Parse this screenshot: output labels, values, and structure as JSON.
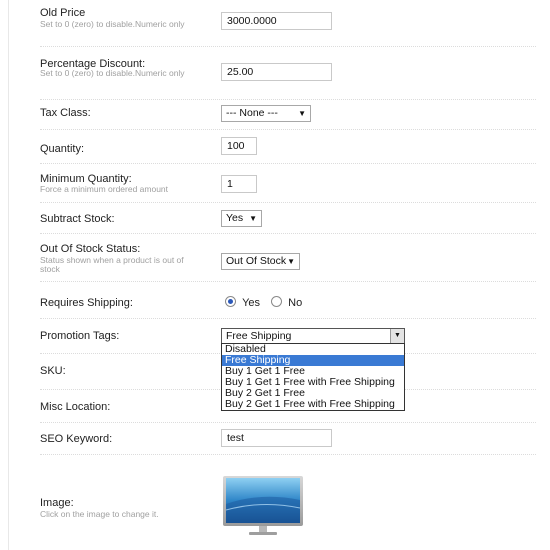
{
  "fields": {
    "old_price": {
      "label": "Old Price",
      "help": "Set to 0 (zero) to disable.Numeric only",
      "value": "3000.0000"
    },
    "percentage_discount": {
      "label": "Percentage Discount:",
      "help": "Set to 0 (zero) to disable.Numeric only",
      "value": "25.00"
    },
    "tax_class": {
      "label": "Tax Class:",
      "value": "--- None ---"
    },
    "quantity": {
      "label": "Quantity:",
      "value": "100"
    },
    "minimum_quantity": {
      "label": "Minimum Quantity:",
      "help": "Force a minimum ordered amount",
      "value": "1"
    },
    "subtract_stock": {
      "label": "Subtract Stock:",
      "value": "Yes"
    },
    "out_of_stock_status": {
      "label": "Out Of Stock Status:",
      "help": "Status shown when a product is out of stock",
      "value": "Out Of Stock"
    },
    "requires_shipping": {
      "label": "Requires Shipping:",
      "yes": "Yes",
      "no": "No",
      "selected": "Yes"
    },
    "promotion_tags": {
      "label": "Promotion Tags:",
      "value": "Free Shipping",
      "options": [
        "Disabled",
        "Free Shipping",
        "Buy 1 Get 1 Free",
        "Buy 1 Get 1 Free with Free Shipping",
        "Buy 2 Get 1 Free",
        "Buy 2 Get 1 Free with Free Shipping"
      ],
      "highlighted": "Free Shipping"
    },
    "sku": {
      "label": "SKU:"
    },
    "misc_location": {
      "label": "Misc Location:"
    },
    "seo_keyword": {
      "label": "SEO Keyword:",
      "value": "test"
    },
    "image": {
      "label": "Image:",
      "help": "Click on the image to change it.",
      "icon": "monitor-image"
    }
  },
  "colors": {
    "highlight": "#3a7ad4",
    "label_help": "#a0a0a0",
    "border": "#c9c9c9"
  }
}
